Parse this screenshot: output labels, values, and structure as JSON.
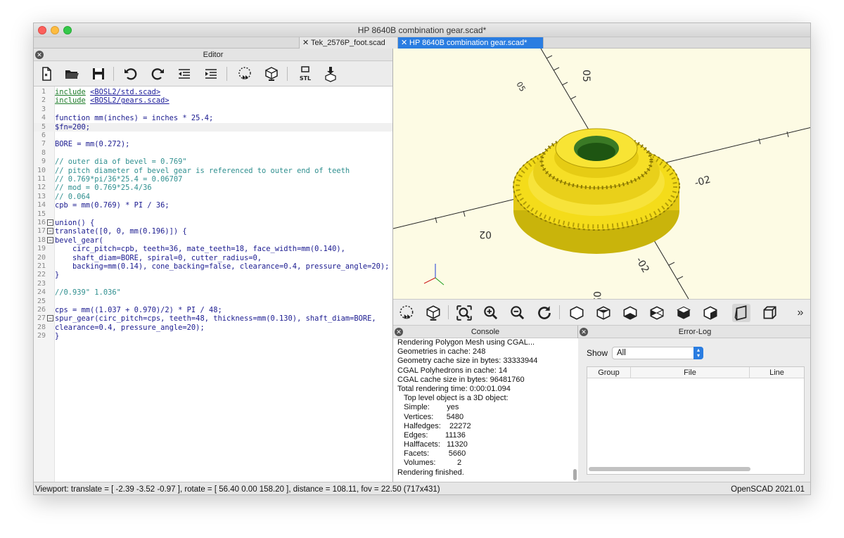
{
  "window": {
    "title": "HP 8640B combination gear.scad*"
  },
  "tabs": [
    {
      "label": "Tek_2576P_foot.scad",
      "active": false
    },
    {
      "label": "HP 8640B combination gear.scad*",
      "active": true
    }
  ],
  "editor": {
    "title": "Editor",
    "toolbar": [
      "new-file-icon",
      "open-file-icon",
      "save-icon",
      "undo-icon",
      "redo-icon",
      "unindent-icon",
      "indent-icon",
      "preview-icon",
      "render-icon",
      "export-stl-icon",
      "send-to-print-icon"
    ]
  },
  "code": {
    "l1": {
      "kw": "include",
      "path": "<BOSL2/std.scad>"
    },
    "l2": {
      "kw": "include",
      "path": "<BOSL2/gears.scad>"
    },
    "l4": "function mm(inches) = inches * 25.4;",
    "l5": "$fn=200;",
    "l7": "BORE = mm(0.272);",
    "l9": "// outer dia of bevel = 0.769\"",
    "l10": "// pitch diameter of bevel gear is referenced to outer end of teeth",
    "l11": "// 0.769*pi/36*25.4 = 0.06707",
    "l12": "// mod = 0.769*25.4/36",
    "l13": "// 0.064",
    "l14": "cpb = mm(0.769) * PI / 36;",
    "l16": "union() {",
    "l17": "translate([0, 0, mm(0.196)]) {",
    "l18": "bevel_gear(",
    "l19": "    circ_pitch=cpb, teeth=36, mate_teeth=18, face_width=mm(0.140),",
    "l20": "    shaft_diam=BORE, spiral=0, cutter_radius=0,",
    "l21": "    backing=mm(0.14), cone_backing=false, clearance=0.4, pressure_angle=20);",
    "l22": "}",
    "l24": "//0.939\" 1.036\"",
    "l26": "cps = mm((1.037 + 0.970)/2) * PI / 48;",
    "l27": "spur_gear(circ_pitch=cps, teeth=48, thickness=mm(0.130), shaft_diam=BORE,",
    "l28": "clearance=0.4, pressure_angle=20);",
    "l29": "}"
  },
  "viewport": {
    "background": "#fdfbe4",
    "gear_color": "#f4dc1a",
    "axis_labels": [
      "05",
      "05",
      "02",
      "02",
      "-02",
      "02",
      "-02",
      "05-"
    ]
  },
  "view_toolbar": [
    "preview-icon",
    "render-icon",
    "zoom-all-icon",
    "zoom-in-icon",
    "zoom-out-icon",
    "reset-view-icon",
    "view-right-icon",
    "view-top-icon",
    "view-bottom-icon",
    "view-left-icon",
    "view-front-icon",
    "view-back-icon",
    "perspective-icon",
    "orthogonal-icon",
    "more-icon"
  ],
  "console": {
    "title": "Console",
    "lines": [
      "Rendering Polygon Mesh using CGAL...",
      "Geometries in cache: 248",
      "Geometry cache size in bytes: 33333944",
      "CGAL Polyhedrons in cache: 14",
      "CGAL cache size in bytes: 96481760",
      "Total rendering time: 0:00:01.094",
      "   Top level object is a 3D object:",
      "   Simple:        yes",
      "   Vertices:      5480",
      "   Halfedges:    22272",
      "   Edges:        11136",
      "   Halffacets:   11320",
      "   Facets:         5660",
      "   Volumes:          2",
      "Rendering finished."
    ]
  },
  "error_log": {
    "title": "Error-Log",
    "show_label": "Show",
    "show_value": "All",
    "columns": [
      "Group",
      "File",
      "Line"
    ]
  },
  "status": {
    "viewport": "Viewport: translate = [ -2.39 -3.52 -0.97 ], rotate = [ 56.40 0.00 158.20 ], distance = 108.11, fov = 22.50 (717x431)",
    "version": "OpenSCAD 2021.01"
  }
}
